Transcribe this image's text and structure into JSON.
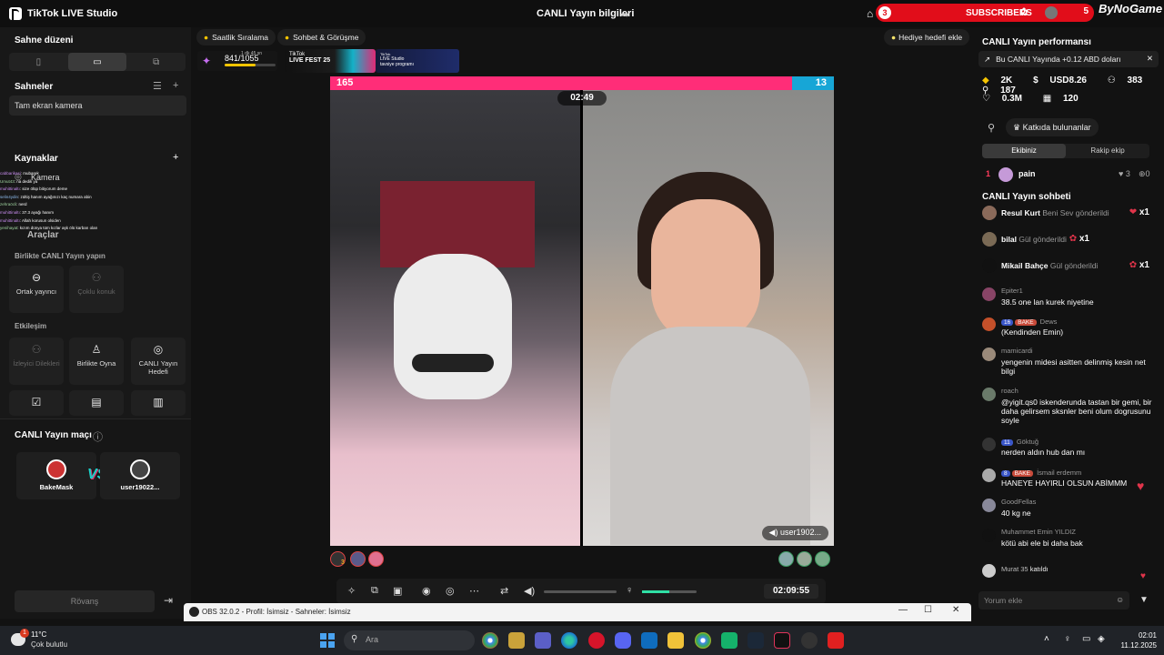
{
  "app": {
    "title": "TikTok LIVE Studio",
    "center_title": "CANLI Yayın bilgileri"
  },
  "overlay": {
    "subs_left": "3",
    "subs_label": "SUBSCRIBERS",
    "subs_right": "5",
    "brand": "ByNoGame"
  },
  "left": {
    "scene_layout_title": "Sahne düzeni",
    "scenes_title": "Sahneler",
    "scene_item": "Tam ekran kamera",
    "sources_title": "Kaynaklar",
    "source_item": "Kamera",
    "tools_title": "Araçlar",
    "together_title": "Birlikte CANLI Yayın yapın",
    "cohost": "Ortak yayıncı",
    "multi_guest": "Çoklu konuk",
    "interaction_title": "Etkileşim",
    "viewer_requests": "İzleyici Dilekleri",
    "play_together": "Birlikte Oyna",
    "live_goal": "CANLI Yayın Hedefi",
    "match_title": "CANLI Yayın maçı",
    "player1": "BakeMask",
    "player2": "user19022...",
    "rematch": "Rövanş"
  },
  "overlay_chat": [
    {
      "user": "cabbarikasi",
      "text": "mubarek"
    },
    {
      "user": "Umut43",
      "text": "na dedik ya"
    },
    {
      "user": "muhittinaltı",
      "text": "size ölüp bitiyorum deme"
    },
    {
      "user": "selin4ydin",
      "text": "zültiş hanım ayağınızı kaç numara abin"
    },
    {
      "user": "zehraöcli",
      "text": "nerd"
    },
    {
      "user": "muhittinaltı",
      "text": "37.3 ayağı hanım"
    },
    {
      "user": "muhittinaltı",
      "text": "Allah korusun olsiden"
    },
    {
      "user": "yenihayat",
      "text": "kızım dünya tüm kızlar aşk ölü karban olan"
    }
  ],
  "center": {
    "pill1": "Saatlik Sıralama",
    "pill2": "Sohbet & Görüşme",
    "stat_value": "841/1055",
    "stat_time": "1 dk 45 sn",
    "banner1_a": "TikTok",
    "banner1_b": "LIVE FEST 25",
    "banner2_a": "TikTok",
    "banner2_b": "LIVE Studio",
    "banner2_c": "tavsiye programı",
    "gift_goal": "Hediye hedefi ekle",
    "score_left": "165",
    "score_right": "13",
    "timer": "02:49",
    "opponent": "user1902...",
    "avatar_count": "3",
    "elapsed": "02:09:55"
  },
  "right": {
    "perf_title": "CANLI Yayın performansı",
    "perf_msg": "Bu CANLI Yayında +0.12 ABD doları",
    "stat_coins": "2K",
    "stat_usd": "USD8.26",
    "stat_viewers": "383",
    "stat_followers": "187",
    "stat_likes": "0.3M",
    "stat_rank": "120",
    "contrib": "Katkıda bulunanlar",
    "tab_yours": "Ekibiniz",
    "tab_rival": "Rakip ekip",
    "rank_num": "1",
    "rank_name": "pain",
    "rank_a": "3",
    "rank_b": "0",
    "chat_title": "CANLI Yayın sohbeti",
    "gifts": [
      {
        "name": "Resul Kurt",
        "action": "Beni Sev gönderildi",
        "count": "x1"
      },
      {
        "name": "bilal",
        "action": "Gül gönderildi",
        "count": "x1"
      },
      {
        "name": "Mikail Bahçe",
        "action": "Gül gönderildi",
        "count": "x1"
      }
    ],
    "messages": [
      {
        "user": "Epiter1",
        "text": "38.5 one lan kurek niyetine"
      },
      {
        "user": "Dews",
        "level": "16",
        "club": "BAKE",
        "text": "(Kendinden Emin)"
      },
      {
        "user": "mamicardi",
        "text": "yengenin midesi asitten delinmiş kesin net bilgi"
      },
      {
        "user": "roach",
        "text": "@yigit.qs0 iskenderunda tastan bir gemi, bir daha gelirsem sksnler beni olum dogrusunu soyle"
      },
      {
        "user": "Göktuğ",
        "level": "11",
        "text": "nerden aldın hub dan mı"
      },
      {
        "user": "İsmail erdemm",
        "level": "8",
        "club": "BAKE",
        "text": "HANEYE HAYIRLI OLSUN ABİMMM"
      },
      {
        "user": "GoodFellas",
        "text": "40 kg ne"
      },
      {
        "user": "Muhammet Emin YILDIZ",
        "text": "kötü abi ele bi daha bak"
      }
    ],
    "joined_user": "Murat 35",
    "joined_text": "katıldı",
    "comment_placeholder": "Yorum ekle"
  },
  "obs": {
    "title": "OBS 32.0.2 - Profil: İsimsiz - Sahneler: İsimsiz"
  },
  "taskbar": {
    "weather_badge": "1",
    "temp": "11°C",
    "weather": "Çok bulutlu",
    "search_placeholder": "Ara",
    "time": "02:01",
    "date": "11.12.2025"
  }
}
